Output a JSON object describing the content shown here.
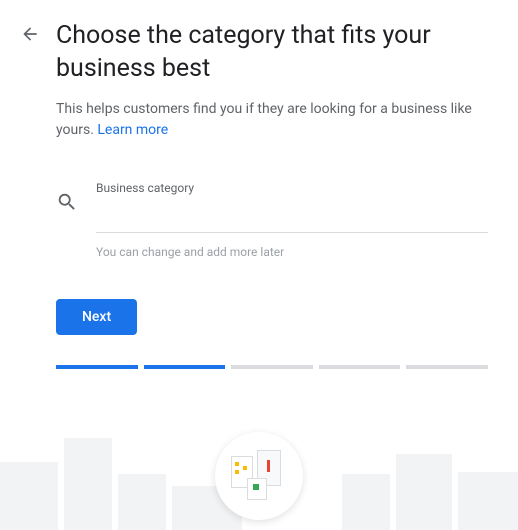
{
  "header": {
    "title": "Choose the category that fits your business best",
    "subtitle_prefix": "This helps customers find you if they are looking for a business like yours. ",
    "learn_more": "Learn more"
  },
  "input": {
    "label": "Business category",
    "value": "",
    "hint": "You can change and add more later"
  },
  "buttons": {
    "next": "Next"
  },
  "progress": {
    "total": 5,
    "current": 2
  }
}
